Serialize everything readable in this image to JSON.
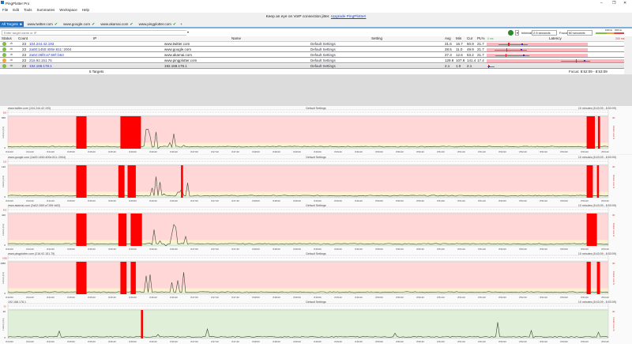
{
  "app": {
    "title": "PingPlotter Pro",
    "minimize": "–",
    "restore": "❐",
    "close": "✕"
  },
  "menu": [
    "File",
    "Edit",
    "Tools",
    "Summaries",
    "Workspace",
    "Help"
  ],
  "banner": {
    "text": "Keep an eye on VoIP connection jitter.",
    "link": "Upgrade PingPlotter!"
  },
  "tabs": {
    "all": "All Targets",
    "targets": [
      "www.twitter.com",
      "www.google.com",
      "www.akamai.com",
      "www.pingplotter.com"
    ],
    "add": "+"
  },
  "toolbar": {
    "placeholder": "Enter target name or IP",
    "interval_label": "Interval",
    "interval": "2.5 seconds",
    "focus_label": "Focus",
    "focus": "60 seconds",
    "legend_100": "100ms",
    "legend_200": "200ms"
  },
  "table": {
    "headers": [
      "Status",
      "Count",
      "IP",
      "Name",
      "Setting",
      "Avg",
      "Min",
      "Cur",
      "PL%",
      "Latency"
    ],
    "lat_min": "0 ms",
    "lat_max": "200 ms",
    "rows": [
      {
        "status": "#7cc142",
        "count": "23",
        "ip": "104.244.42.193",
        "name": "www.twitter.com",
        "setting": "Default Settings",
        "avg": "31.6",
        "min": "16.7",
        "cur": "50.9",
        "pl": "21.7"
      },
      {
        "status": "#7cc142",
        "count": "23",
        "ip": "2a00:1450:400e:811::2004",
        "name": "www.google.com",
        "setting": "Default Settings",
        "avg": "28.5",
        "min": "11.0",
        "cur": "49.9",
        "pl": "21.7"
      },
      {
        "status": "#7cc142",
        "count": "23",
        "ip": "2a02:26f0:a7:59f::b63",
        "name": "www.akamai.com",
        "setting": "Default Settings",
        "avg": "27.3",
        "min": "12.6",
        "cur": "53.2",
        "pl": "21.7"
      },
      {
        "status": "#f5a33a",
        "count": "23",
        "ip": "216.92.151.75",
        "name": "www.pingplotter.com",
        "setting": "Default Settings",
        "avg": "129.8",
        "min": "107.8",
        "cur": "141.4",
        "pl": "17.4"
      },
      {
        "status": "#7cc142",
        "count": "23",
        "ip": "192.168.178.1",
        "name": "192.168.178.1",
        "setting": "Default Settings",
        "avg": "2.1",
        "min": "1.0",
        "cur": "2.1",
        "pl": ""
      }
    ],
    "summary": "5 Targets",
    "focus": "Focus: 8:52:09 - 8:53:09"
  },
  "graphs": {
    "setting": "Default Settings",
    "range": "10 minutes (8:43:09 - 8:53:09)",
    "max_label": "Max (ms)",
    "ylabel": "Latency (ms)",
    "y2label": "Packet Loss %",
    "y2max": "30",
    "ymin": "0",
    "times": [
      "8:44:00",
      "8:44:20",
      "8:44:40",
      "8:45:00",
      "8:45:20",
      "8:45:40",
      "8:46:00",
      "8:46:20",
      "8:46:40",
      "8:47:00",
      "8:47:20",
      "8:47:40",
      "8:48:00",
      "8:48:20",
      "8:48:40",
      "8:49:00",
      "8:49:20",
      "8:49:40",
      "8:50:00",
      "8:50:20",
      "8:50:40",
      "8:51:00",
      "8:51:20",
      "8:51:40",
      "8:52:00",
      "8:52:20",
      "8:52:40",
      "8:53:00",
      "8:53:20",
      "8:53:40"
    ]
  },
  "chart_data": [
    {
      "type": "line",
      "title": "www.twitter.com (104.244.42.193)",
      "ymax": "650",
      "loss_periods_s": [
        [
          65,
          75
        ],
        [
          108,
          128
        ],
        [
          562,
          570
        ],
        [
          573,
          575
        ]
      ],
      "bands": "bad"
    },
    {
      "type": "line",
      "title": "www.google.com (2a00:1450:400e:811::2004)",
      "ymax": "120",
      "loss_periods_s": [
        [
          65,
          75
        ],
        [
          106,
          112
        ],
        [
          115,
          123
        ],
        [
          167,
          169
        ],
        [
          562,
          568
        ],
        [
          572,
          574
        ]
      ],
      "bands": "bad"
    },
    {
      "type": "line",
      "title": "www.akamai.com (2a02:26f0:a7:59f::b63)",
      "ymax": "420",
      "loss_periods_s": [
        [
          65,
          75
        ],
        [
          106,
          114
        ],
        [
          118,
          129
        ],
        [
          562,
          572
        ]
      ],
      "bands": "bad"
    },
    {
      "type": "line",
      "title": "www.pingplotter.com (216.92.151.75)",
      "ymax": "1080",
      "loss_periods_s": [
        [
          65,
          75
        ],
        [
          108,
          114
        ],
        [
          118,
          123
        ],
        [
          562,
          566
        ],
        [
          572,
          575
        ]
      ],
      "bands": "bad"
    },
    {
      "type": "line",
      "title": "192.168.178.1",
      "ymax": "30",
      "loss_periods_s": [
        [
          128,
          130
        ]
      ],
      "bands": "good"
    }
  ],
  "colors": {
    "loss": "#ff0000",
    "bad": "#ffd7d7",
    "warn": "#fff1cc",
    "good": "#e0efd8",
    "line": "#3b4a3b"
  }
}
